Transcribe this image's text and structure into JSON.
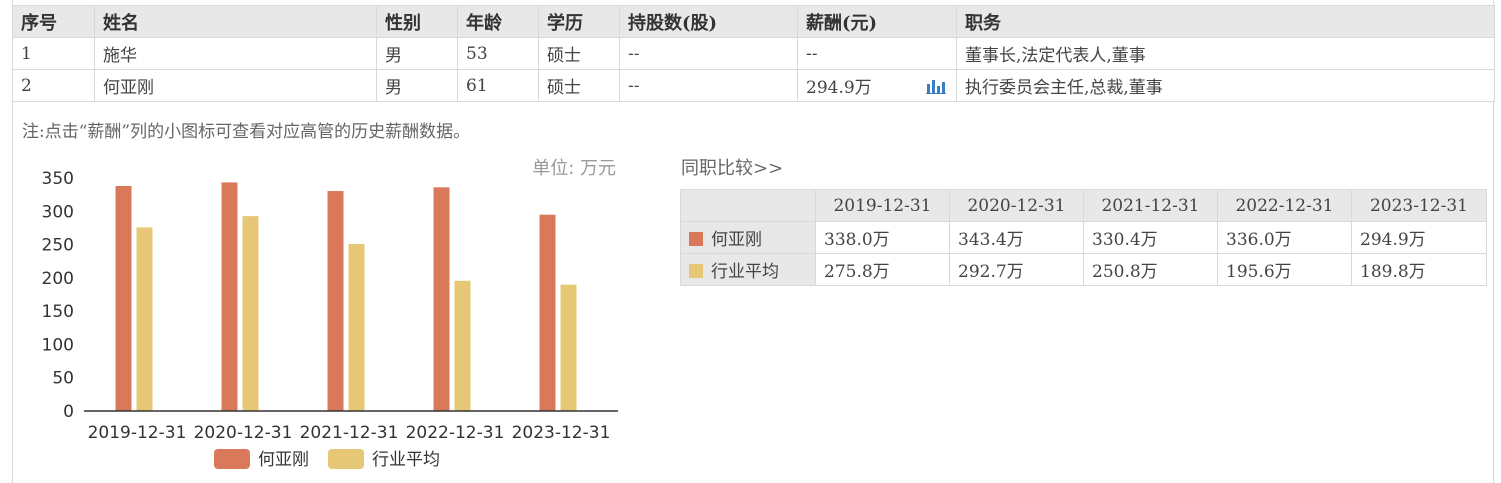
{
  "colors": {
    "person": "#d9785a",
    "industry": "#e5c775",
    "header_bg": "#e8e8e8",
    "border": "#d9d9d9",
    "icon": "#3b7dc4"
  },
  "table": {
    "headers": [
      "序号",
      "姓名",
      "性别",
      "年龄",
      "学历",
      "持股数(股)",
      "薪酬(元)",
      "职务"
    ],
    "rows": [
      {
        "no": "1",
        "name": "施华",
        "gender": "男",
        "age": "53",
        "edu": "硕士",
        "shares": "--",
        "salary": "--",
        "title": "董事长,法定代表人,董事",
        "salary_icon": false
      },
      {
        "no": "2",
        "name": "何亚刚",
        "gender": "男",
        "age": "61",
        "edu": "硕士",
        "shares": "--",
        "salary": "294.9万",
        "title": "执行委员会主任,总裁,董事",
        "salary_icon": true,
        "icon": "bar-chart-icon"
      }
    ]
  },
  "note": "注:点击“薪酬”列的小图标可查看对应高管的历史薪酬数据。",
  "chart_data": {
    "type": "bar",
    "unit_label": "单位: 万元",
    "categories": [
      "2019-12-31",
      "2020-12-31",
      "2021-12-31",
      "2022-12-31",
      "2023-12-31"
    ],
    "series": [
      {
        "name": "何亚刚",
        "values": [
          338.0,
          343.4,
          330.4,
          336.0,
          294.9
        ],
        "color": "#d9785a"
      },
      {
        "name": "行业平均",
        "values": [
          275.8,
          292.7,
          250.8,
          195.6,
          189.8
        ],
        "color": "#e5c775"
      }
    ],
    "yticks": [
      0,
      50,
      100,
      150,
      200,
      250,
      300,
      350
    ],
    "ylim": [
      0,
      350
    ],
    "grid": false,
    "legend": "bottom"
  },
  "compare": {
    "link": "同职比较>>",
    "headers": [
      "",
      "2019-12-31",
      "2020-12-31",
      "2021-12-31",
      "2022-12-31",
      "2023-12-31"
    ],
    "rows": [
      {
        "label": "何亚刚",
        "color": "#d9785a",
        "cells": [
          "338.0万",
          "343.4万",
          "330.4万",
          "336.0万",
          "294.9万"
        ]
      },
      {
        "label": "行业平均",
        "color": "#e5c775",
        "cells": [
          "275.8万",
          "292.7万",
          "250.8万",
          "195.6万",
          "189.8万"
        ]
      }
    ]
  }
}
